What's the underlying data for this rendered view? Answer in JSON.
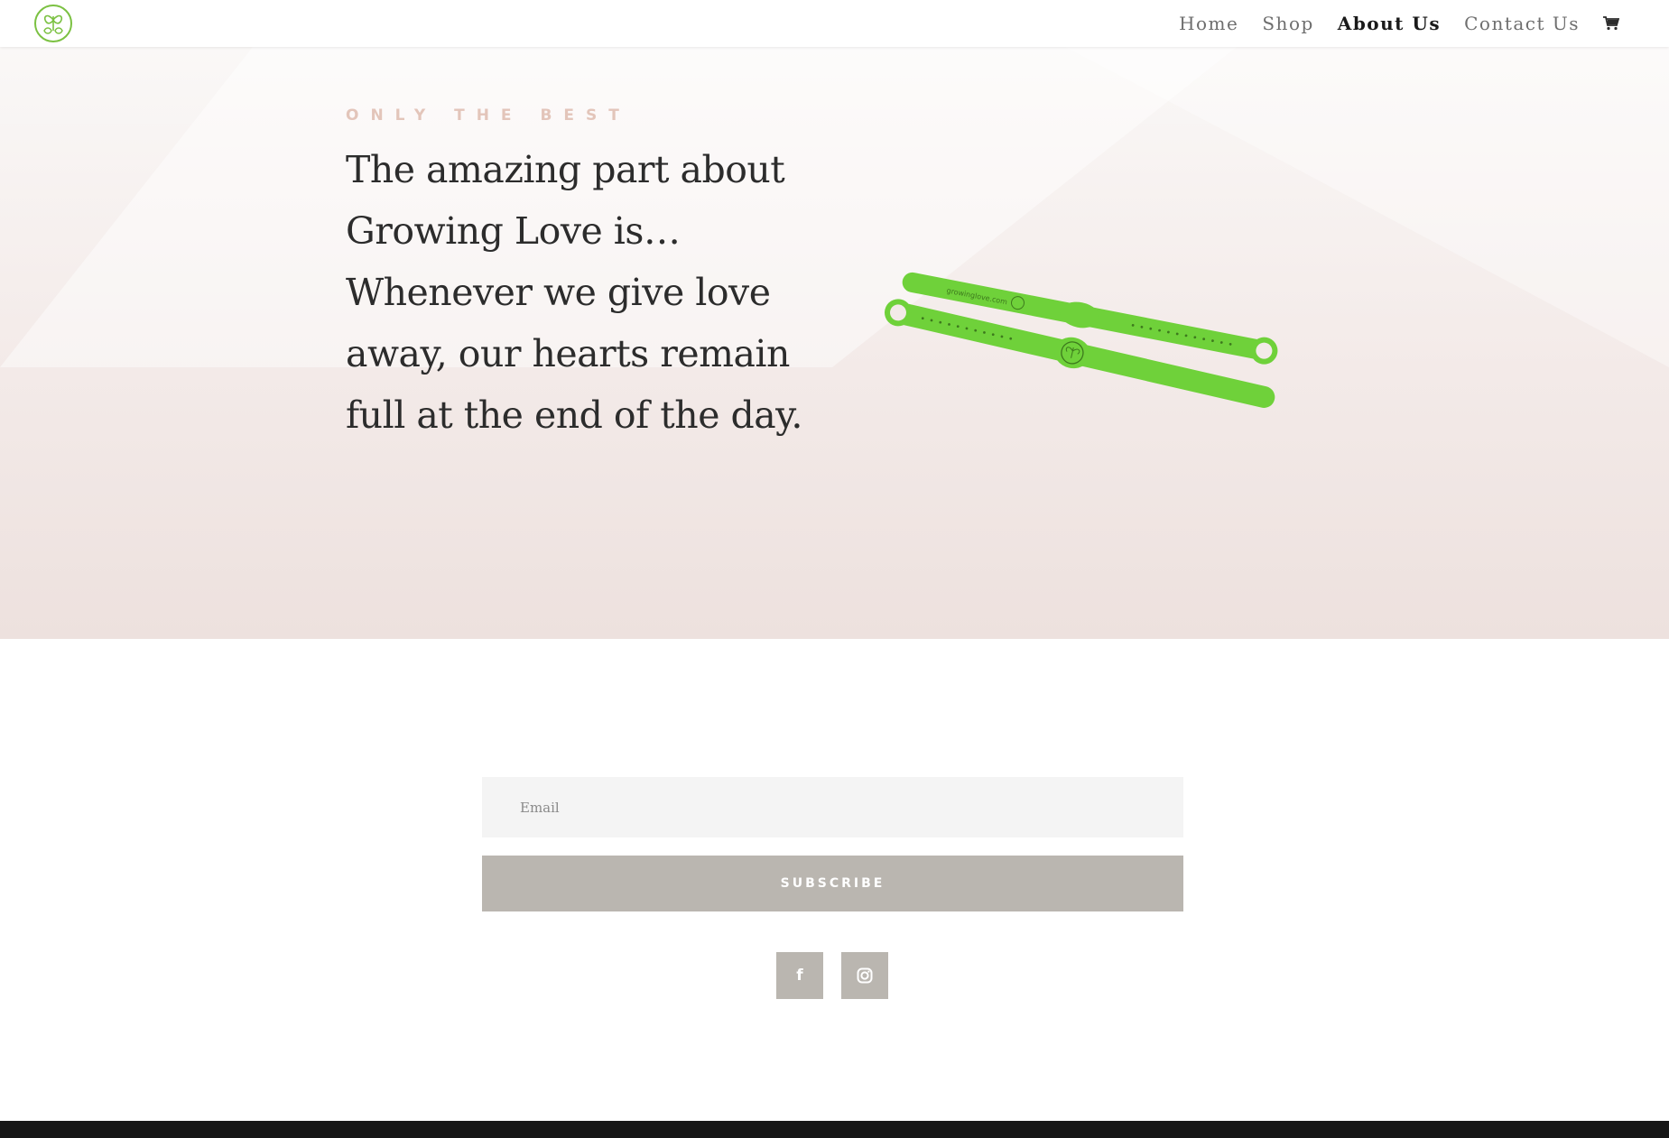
{
  "header": {
    "logo_icon": "growing-love-leaf-logo",
    "nav": [
      {
        "label": "Home"
      },
      {
        "label": "Shop"
      },
      {
        "label": "About Us",
        "active": true
      },
      {
        "label": "Contact Us"
      }
    ],
    "cart_icon": "cart-icon"
  },
  "hero": {
    "kicker": "ONLY THE BEST",
    "headline": "The amazing part about Growing Love is… Whenever we give love away, our hearts remain full at the end of the day.",
    "image_icon": "green-bracelet-product-image",
    "bracelet_text": "growinglove.com",
    "bracelet_color": "#6fd13a"
  },
  "subscribe": {
    "email_placeholder": "Email",
    "button_label": "SUBSCRIBE",
    "button_color": "#bab6b0"
  },
  "social": [
    {
      "icon": "facebook-icon",
      "glyph": "f"
    },
    {
      "icon": "instagram-icon"
    }
  ],
  "colors": {
    "accent_green": "#7bc142",
    "kicker": "#e3c5ba",
    "footer": "#161616"
  }
}
